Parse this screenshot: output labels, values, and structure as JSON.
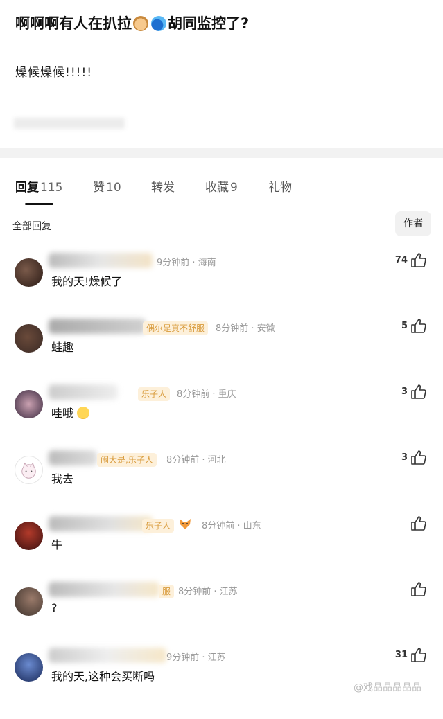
{
  "post": {
    "title_part1": "啊啊啊有人在扒拉",
    "title_part2": "胡同监控了?",
    "body": "燥候燥候!!!!!"
  },
  "tabs": [
    {
      "label": "回复",
      "count": "115"
    },
    {
      "label": "赞",
      "count": "10"
    },
    {
      "label": "转发",
      "count": ""
    },
    {
      "label": "收藏",
      "count": "9"
    },
    {
      "label": "礼物",
      "count": ""
    }
  ],
  "section": {
    "all_replies": "全部回复",
    "author_filter": "作者"
  },
  "comments": [
    {
      "badge": "",
      "meta": "9分钟前 · 海南",
      "text": "我的天!燥候了",
      "likes": "74"
    },
    {
      "badge": "偶尔是真不舒服",
      "meta": "8分钟前 · 安徽",
      "text": "蛙趣",
      "likes": "5"
    },
    {
      "badge": "乐子人",
      "meta": "8分钟前 · 重庆",
      "text": "哇哦",
      "likes": "3"
    },
    {
      "badge": "闹大是,乐子人",
      "meta": "8分钟前 · 河北",
      "text": "我去",
      "likes": "3"
    },
    {
      "badge": "乐子人",
      "meta": "8分钟前 · 山东",
      "text": "牛",
      "likes": ""
    },
    {
      "badge": "服",
      "meta": "8分钟前 · 江苏",
      "text": "?",
      "likes": ""
    },
    {
      "badge": "",
      "meta": "9分钟前 · 江苏",
      "text": "我的天,这种会买断吗",
      "likes": "31"
    }
  ],
  "watermark": "@戏晶晶晶晶晶",
  "colors": {
    "badge_text": "#d89a3a",
    "badge_bg": "#fdf0da",
    "meta": "#999999"
  }
}
